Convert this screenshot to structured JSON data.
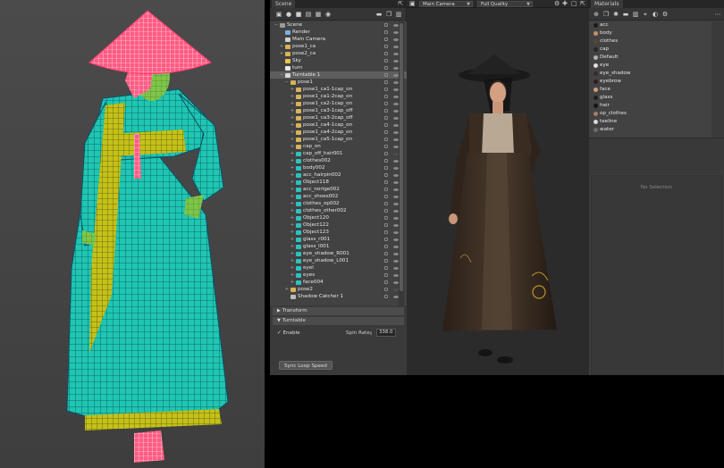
{
  "scene_panel": {
    "tab_title": "Scene",
    "toolbar_icons": [
      "add-object-icon",
      "light-icon",
      "camera-icon",
      "environment-icon",
      "grid-icon",
      "material-icon",
      "folder-icon",
      "duplicate-icon",
      "delete-icon"
    ],
    "tree": [
      {
        "label": "Scene",
        "depth": 0,
        "icon": "scene",
        "expand": "−",
        "selected": false,
        "visible": true
      },
      {
        "label": "Render",
        "depth": 1,
        "icon": "render",
        "expand": "",
        "selected": false,
        "visible": true
      },
      {
        "label": "Main Camera",
        "depth": 1,
        "icon": "camera",
        "expand": "",
        "selected": false,
        "visible": true
      },
      {
        "label": "pose1_ca",
        "depth": 1,
        "icon": "folder",
        "expand": "+",
        "selected": false,
        "visible": true
      },
      {
        "label": "pose2_ca",
        "depth": 1,
        "icon": "folder",
        "expand": "+",
        "selected": false,
        "visible": true
      },
      {
        "label": "Sky",
        "depth": 1,
        "icon": "sky",
        "expand": "",
        "selected": false,
        "visible": true
      },
      {
        "label": "turn",
        "depth": 1,
        "icon": "light",
        "expand": "",
        "selected": false,
        "visible": true
      },
      {
        "label": "Turntable 1",
        "depth": 1,
        "icon": "turntable",
        "expand": "−",
        "selected": true,
        "visible": true
      },
      {
        "label": "pose1",
        "depth": 2,
        "icon": "folder",
        "expand": "−",
        "selected": false,
        "visible": true
      },
      {
        "label": "pose1_ca1-1cap_on",
        "depth": 3,
        "icon": "folder",
        "expand": "+",
        "selected": false,
        "visible": true
      },
      {
        "label": "pose1_ca1-2cap_on",
        "depth": 3,
        "icon": "folder",
        "expand": "+",
        "selected": false,
        "visible": true
      },
      {
        "label": "pose1_ca2-1cap_on",
        "depth": 3,
        "icon": "folder",
        "expand": "+",
        "selected": false,
        "visible": true
      },
      {
        "label": "pose1_ca3-1cap_off",
        "depth": 3,
        "icon": "folder",
        "expand": "+",
        "selected": false,
        "visible": true
      },
      {
        "label": "pose1_ca3-2cap_off",
        "depth": 3,
        "icon": "folder",
        "expand": "+",
        "selected": false,
        "visible": true
      },
      {
        "label": "pose1_ca4-1cap_on",
        "depth": 3,
        "icon": "folder",
        "expand": "+",
        "selected": false,
        "visible": true
      },
      {
        "label": "pose1_ca4-2cap_on",
        "depth": 3,
        "icon": "folder",
        "expand": "+",
        "selected": false,
        "visible": true
      },
      {
        "label": "pose1_ca5-1cap_on",
        "depth": 3,
        "icon": "folder",
        "expand": "+",
        "selected": false,
        "visible": true
      },
      {
        "label": "cap_on",
        "depth": 3,
        "icon": "folder",
        "expand": "+",
        "selected": false,
        "visible": true
      },
      {
        "label": "cap_off_hair001",
        "depth": 3,
        "icon": "mesh",
        "expand": "+",
        "selected": false,
        "visible": false
      },
      {
        "label": "clothes002",
        "depth": 3,
        "icon": "mesh",
        "expand": "+",
        "selected": false,
        "visible": true
      },
      {
        "label": "body002",
        "depth": 3,
        "icon": "mesh",
        "expand": "+",
        "selected": false,
        "visible": true
      },
      {
        "label": "acc_hairpin002",
        "depth": 3,
        "icon": "mesh",
        "expand": "+",
        "selected": false,
        "visible": true
      },
      {
        "label": "Object118",
        "depth": 3,
        "icon": "mesh",
        "expand": "+",
        "selected": false,
        "visible": true
      },
      {
        "label": "acc_norige002",
        "depth": 3,
        "icon": "mesh",
        "expand": "+",
        "selected": false,
        "visible": true
      },
      {
        "label": "acc_shoes002",
        "depth": 3,
        "icon": "mesh",
        "expand": "+",
        "selected": false,
        "visible": true
      },
      {
        "label": "clothes_op002",
        "depth": 3,
        "icon": "mesh",
        "expand": "+",
        "selected": false,
        "visible": true
      },
      {
        "label": "clothes_other002",
        "depth": 3,
        "icon": "mesh",
        "expand": "+",
        "selected": false,
        "visible": true
      },
      {
        "label": "Object120",
        "depth": 3,
        "icon": "mesh",
        "expand": "+",
        "selected": false,
        "visible": true
      },
      {
        "label": "Object122",
        "depth": 3,
        "icon": "mesh",
        "expand": "+",
        "selected": false,
        "visible": true
      },
      {
        "label": "Object123",
        "depth": 3,
        "icon": "mesh",
        "expand": "+",
        "selected": false,
        "visible": true
      },
      {
        "label": "glass_r001",
        "depth": 3,
        "icon": "mesh",
        "expand": "+",
        "selected": false,
        "visible": true
      },
      {
        "label": "glass_l001",
        "depth": 3,
        "icon": "mesh",
        "expand": "+",
        "selected": false,
        "visible": true
      },
      {
        "label": "eye_shadow_R001",
        "depth": 3,
        "icon": "mesh",
        "expand": "+",
        "selected": false,
        "visible": true
      },
      {
        "label": "eye_shadow_L001",
        "depth": 3,
        "icon": "mesh",
        "expand": "+",
        "selected": false,
        "visible": true
      },
      {
        "label": "eyel",
        "depth": 3,
        "icon": "mesh",
        "expand": "+",
        "selected": false,
        "visible": true
      },
      {
        "label": "eyes",
        "depth": 3,
        "icon": "mesh",
        "expand": "+",
        "selected": false,
        "visible": true
      },
      {
        "label": "face004",
        "depth": 3,
        "icon": "mesh",
        "expand": "+",
        "selected": false,
        "visible": true
      },
      {
        "label": "pose2",
        "depth": 2,
        "icon": "folder",
        "expand": "+",
        "selected": false,
        "visible": false
      },
      {
        "label": "Shadow Catcher 1",
        "depth": 2,
        "icon": "shadow",
        "expand": "",
        "selected": false,
        "visible": true
      }
    ],
    "transform_label": "Transform",
    "turntable_label": "Turntable",
    "enable_label": "Enable",
    "enable_checked": true,
    "spin_rate_label": "Spin Rate",
    "spin_rate_value": "338.0",
    "sync_button_label": "Sync Loop Speed"
  },
  "viewport": {
    "camera_select": "Main Camera",
    "quality_select": "Full Quality",
    "icons": [
      "camera-icon",
      "settings-icon",
      "move-icon",
      "frame-icon",
      "popout-icon"
    ]
  },
  "materials_panel": {
    "tab_title": "Materials",
    "toolbar_icons": [
      "add-material-icon",
      "duplicate-icon",
      "transfer-icon",
      "folder-icon",
      "delete-icon",
      "pick-icon",
      "clear-icon",
      "settings-icon"
    ],
    "items": [
      {
        "name": "acc",
        "color": "#1a1a1a"
      },
      {
        "name": "body",
        "color": "#c89070"
      },
      {
        "name": "clothes",
        "color": "#5a4434"
      },
      {
        "name": "cap",
        "color": "#2c2420"
      },
      {
        "name": "Default",
        "color": "#b0b0b0"
      },
      {
        "name": "eye",
        "color": "#e0e0e0"
      },
      {
        "name": "eye_shadow",
        "color": "#3a2a26"
      },
      {
        "name": "eyebrow",
        "color": "#2a1e1a"
      },
      {
        "name": "face",
        "color": "#d09a78"
      },
      {
        "name": "glass",
        "color": "#1e1e1e"
      },
      {
        "name": "hair",
        "color": "#151515"
      },
      {
        "name": "op_clothes",
        "color": "#a08060"
      },
      {
        "name": "teeline",
        "color": "#d8d8d8"
      },
      {
        "name": "water",
        "color": "#6a6a6a"
      }
    ],
    "no_selection_text": "No Selection"
  },
  "colors": {
    "panel_bg": "#3c3c3c",
    "selection": "#5e5e5e",
    "wire_green": "#1fc6b0",
    "wire_yellow": "#c7c21a",
    "wire_red": "#ff3a6e"
  }
}
